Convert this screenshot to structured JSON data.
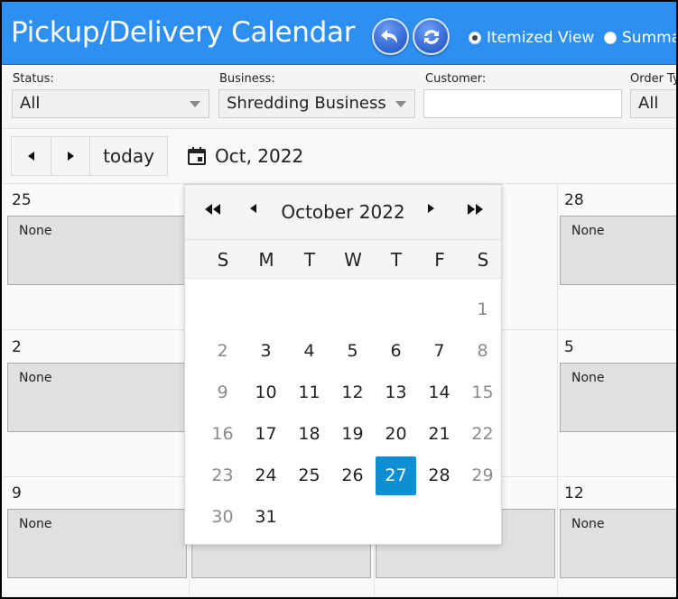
{
  "header": {
    "title": "Pickup/Delivery Calendar",
    "undo_icon": "undo-arrow-icon",
    "refresh_icon": "refresh-icon",
    "view_options": [
      {
        "label": "Itemized View",
        "checked": true
      },
      {
        "label": "Summa",
        "checked": false
      }
    ],
    "bg_color": "#2d8ff0"
  },
  "filters": {
    "status": {
      "label": "Status:",
      "value": "All"
    },
    "business": {
      "label": "Business:",
      "value": "Shredding Business"
    },
    "customer": {
      "label": "Customer:",
      "value": ""
    },
    "order_type": {
      "label": "Order Ty",
      "value": "All"
    }
  },
  "toolbar": {
    "prev_icon": "chevron-left-icon",
    "next_icon": "chevron-right-icon",
    "today_label": "today",
    "calendar_icon": "calendar-icon",
    "current_date": "Oct, 2022"
  },
  "calendar": {
    "rows": [
      {
        "left_day": "25",
        "right_day": "28"
      },
      {
        "left_day": "2",
        "right_day": "5"
      },
      {
        "left_day": "9",
        "right_day": "12"
      }
    ],
    "event_text": "None"
  },
  "datepicker": {
    "title": "October 2022",
    "prev_year_icon": "double-chevron-left-icon",
    "prev_month_icon": "chevron-left-icon",
    "next_month_icon": "chevron-right-icon",
    "next_year_icon": "double-chevron-right-icon",
    "weekdays": [
      "S",
      "M",
      "T",
      "W",
      "T",
      "F",
      "S"
    ],
    "weeks": [
      [
        "",
        "",
        "",
        "",
        "",
        "",
        "1"
      ],
      [
        "2",
        "3",
        "4",
        "5",
        "6",
        "7",
        "8"
      ],
      [
        "9",
        "10",
        "11",
        "12",
        "13",
        "14",
        "15"
      ],
      [
        "16",
        "17",
        "18",
        "19",
        "20",
        "21",
        "22"
      ],
      [
        "23",
        "24",
        "25",
        "26",
        "27",
        "28",
        "29"
      ],
      [
        "30",
        "31",
        "",
        "",
        "",
        "",
        ""
      ]
    ],
    "selected": "27",
    "selected_color": "#0e8fd3"
  }
}
